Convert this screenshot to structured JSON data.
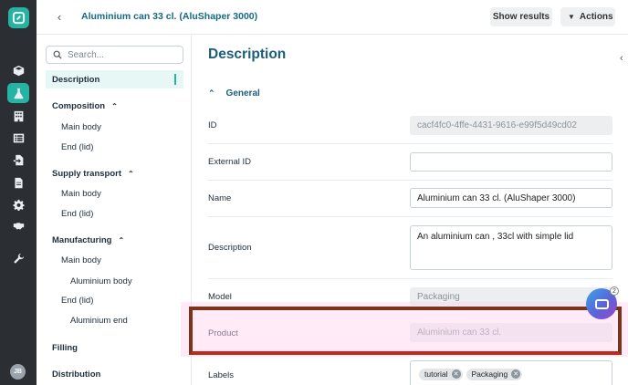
{
  "rail": {
    "logo": "app-logo-icon",
    "items": [
      {
        "icon": "box-icon"
      },
      {
        "icon": "flask-icon",
        "active": true
      },
      {
        "icon": "building-icon"
      },
      {
        "icon": "list-icon"
      },
      {
        "icon": "file-import-icon"
      },
      {
        "icon": "document-icon"
      },
      {
        "icon": "gear-icon"
      },
      {
        "icon": "handshake-icon"
      },
      {
        "icon": "wrench-icon"
      }
    ],
    "avatar": "JB"
  },
  "topbar": {
    "title": "Aluminium can 33 cl. (AluShaper 3000)",
    "show_results": "Show results",
    "actions": "Actions"
  },
  "nav": {
    "search_placeholder": "Search...",
    "items": [
      {
        "label": "Description",
        "selected": true
      },
      {
        "label": "Composition"
      },
      {
        "label": "Main body"
      },
      {
        "label": "End (lid)"
      },
      {
        "label": "Supply transport"
      },
      {
        "label": "Main body"
      },
      {
        "label": "End (lid)"
      },
      {
        "label": "Manufacturing"
      },
      {
        "label": "Main body"
      },
      {
        "label": "Aluminium body"
      },
      {
        "label": "End (lid)"
      },
      {
        "label": "Aluminium end"
      },
      {
        "label": "Filling"
      },
      {
        "label": "Distribution"
      }
    ]
  },
  "main": {
    "heading": "Description",
    "section": "General",
    "fields": {
      "id": {
        "label": "ID",
        "value": "cacf4fc0-4ffe-4431-9616-e99f5d49cd02"
      },
      "external_id": {
        "label": "External ID",
        "value": ""
      },
      "name": {
        "label": "Name",
        "value": "Aluminium can 33 cl. (AluShaper 3000)"
      },
      "description": {
        "label": "Description",
        "value": "An aluminium can , 33cl with simple lid"
      },
      "model": {
        "label": "Model",
        "value": "Packaging"
      },
      "product": {
        "label": "Product",
        "value": "Aluminium can 33 cl."
      },
      "labels": {
        "label": "Labels",
        "tags": [
          "tutorial",
          "Packaging"
        ]
      }
    }
  },
  "chat": {
    "badge": "2"
  },
  "colors": {
    "accent": "#25b4a4",
    "heading": "#1b5f77",
    "highlight": "#7a3417"
  }
}
